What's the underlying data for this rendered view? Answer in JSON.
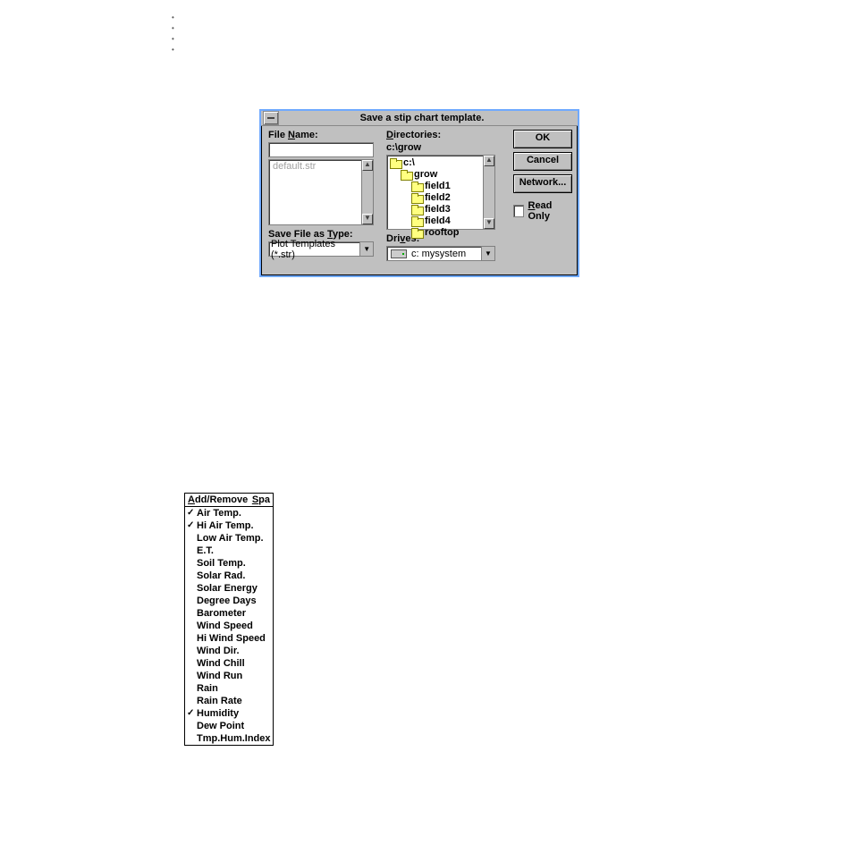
{
  "dialog": {
    "title": "Save a stip chart template.",
    "filename_label": "File Name:",
    "filename_value": "",
    "file_list_disabled": "default.str",
    "directories_label": "Directories:",
    "current_dir": "c:\\grow",
    "dir_tree": {
      "root": "c:\\",
      "level1": "grow",
      "children": [
        "field1",
        "field2",
        "field3",
        "field4",
        "rooftop"
      ]
    },
    "save_type_label": "Save File as Type:",
    "save_type_value": "Plot Templates (*.str)",
    "drives_label": "Drives:",
    "drives_value": "c: mysystem",
    "ok": "OK",
    "cancel": "Cancel",
    "network": "Network...",
    "readonly": "Read Only"
  },
  "menu": {
    "left_label": "Add/Remove",
    "right_label": "Spa",
    "items": [
      {
        "label": "Air Temp.",
        "checked": true
      },
      {
        "label": "Hi Air Temp.",
        "checked": true
      },
      {
        "label": "Low Air Temp.",
        "checked": false
      },
      {
        "label": "E.T.",
        "checked": false
      },
      {
        "label": "Soil Temp.",
        "checked": false
      },
      {
        "label": "Solar Rad.",
        "checked": false
      },
      {
        "label": "Solar Energy",
        "checked": false
      },
      {
        "label": "Degree Days",
        "checked": false
      },
      {
        "label": "Barometer",
        "checked": false
      },
      {
        "label": "Wind Speed",
        "checked": false
      },
      {
        "label": "Hi Wind Speed",
        "checked": false
      },
      {
        "label": "Wind Dir.",
        "checked": false
      },
      {
        "label": "Wind Chill",
        "checked": false
      },
      {
        "label": "Wind Run",
        "checked": false
      },
      {
        "label": "Rain",
        "checked": false
      },
      {
        "label": "Rain Rate",
        "checked": false
      },
      {
        "label": "Humidity",
        "checked": true
      },
      {
        "label": "Dew Point",
        "checked": false
      },
      {
        "label": "Tmp.Hum.Index",
        "checked": false
      }
    ]
  }
}
